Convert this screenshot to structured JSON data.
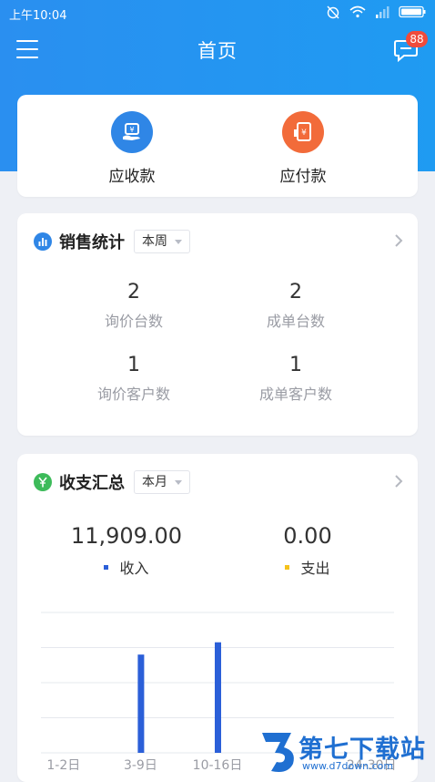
{
  "status_bar": {
    "time": "上午10:04"
  },
  "header": {
    "title": "首页",
    "message_count": "88"
  },
  "quick_actions": [
    {
      "label": "应收款",
      "icon": "receivable-icon",
      "color": "#2f86e6"
    },
    {
      "label": "应付款",
      "icon": "payable-icon",
      "color": "#f26b3a"
    }
  ],
  "sales_stats": {
    "title": "销售统计",
    "period": "本周",
    "items": [
      {
        "value": "2",
        "label": "询价台数"
      },
      {
        "value": "2",
        "label": "成单台数"
      },
      {
        "value": "1",
        "label": "询价客户数"
      },
      {
        "value": "1",
        "label": "成单客户数"
      }
    ]
  },
  "finance": {
    "title": "收支汇总",
    "period": "本月",
    "income": {
      "value": "11,909.00",
      "label": "收入",
      "color": "#2b5fd8"
    },
    "expense": {
      "value": "0.00",
      "label": "支出",
      "color": "#f5c21b"
    }
  },
  "chart_data": {
    "type": "bar",
    "categories": [
      "1-2日",
      "3-9日",
      "10-16日",
      "17-23日",
      "24-30日"
    ],
    "visible_tick_labels": [
      "1-2日",
      "3-9日",
      "10-16日",
      "",
      "24-30日"
    ],
    "series": [
      {
        "name": "收入",
        "values": [
          0,
          5600,
          6300,
          0,
          0
        ],
        "color": "#2b5fd8"
      }
    ],
    "ylim": [
      0,
      8000
    ],
    "grid": true
  },
  "watermark": {
    "text": "第七下载站",
    "subtext": "www.d7down.com"
  }
}
